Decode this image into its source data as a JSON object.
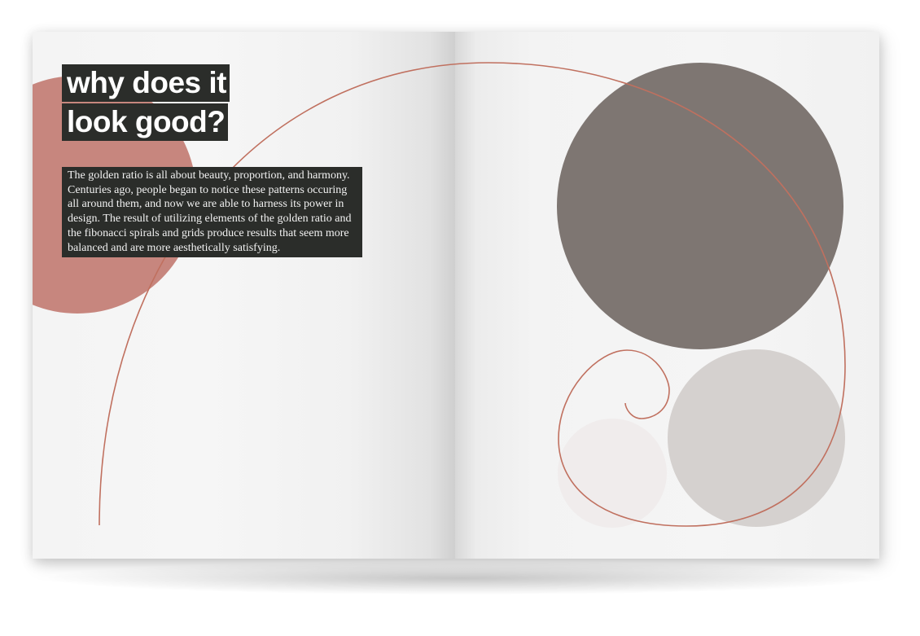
{
  "left_page": {
    "headline_line_1": "why does it",
    "headline_line_2": "look good?",
    "body_text": "The golden ratio is all about beauty, proportion, and harmony. Centuries ago, people began to notice these patterns occuring all around them, and now we are able to harness its power in design. The result of utilizing elements of the golden ratio and the fibonacci spirals and grids produce results that seem more balanced and are more aesthetically satisfying."
  },
  "colors": {
    "accent_circle": "#c0766d",
    "text_box_bg": "#2b2d2a",
    "spiral_stroke": "#c0705f",
    "large_circle": "#7e7672",
    "medium_circle": "#d5d1cf",
    "small_circle": "#efebeb"
  }
}
